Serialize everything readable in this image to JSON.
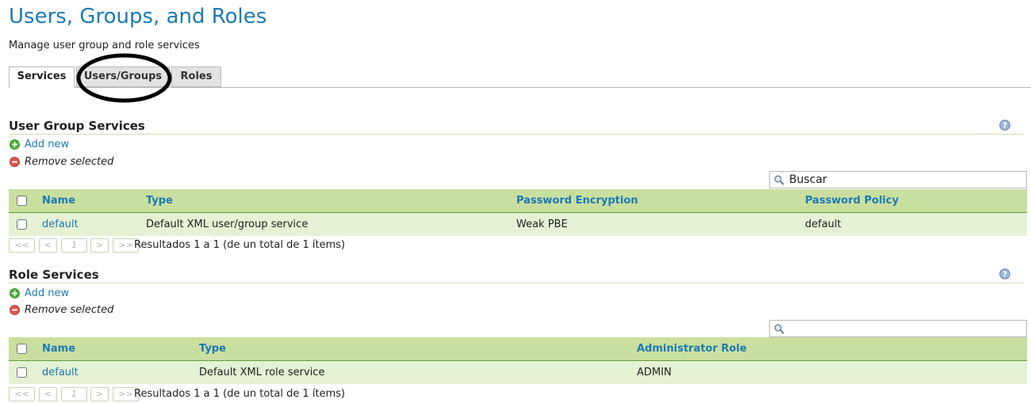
{
  "page": {
    "title": "Users, Groups, and Roles",
    "subtitle": "Manage user group and role services"
  },
  "tabs": [
    {
      "label": "Services",
      "active": true
    },
    {
      "label": "Users/Groups",
      "active": false
    },
    {
      "label": "Roles",
      "active": false
    }
  ],
  "user_group_services": {
    "heading": "User Group Services",
    "add_label": "Add new",
    "remove_label": "Remove selected",
    "search_placeholder": "Buscar",
    "columns": [
      "Name",
      "Type",
      "Password Encryption",
      "Password Policy"
    ],
    "rows": [
      {
        "name": "default",
        "type": "Default XML user/group service",
        "encryption": "Weak PBE",
        "policy": "default"
      }
    ],
    "pager": {
      "first": "<<",
      "prev": "<",
      "page": "1",
      "next": ">",
      "last": ">>",
      "result": "Resultados 1 a 1 (de un total de 1 ítems)"
    }
  },
  "role_services": {
    "heading": "Role Services",
    "add_label": "Add new",
    "remove_label": "Remove selected",
    "search_placeholder": "",
    "columns": [
      "Name",
      "Type",
      "Administrator Role"
    ],
    "rows": [
      {
        "name": "default",
        "type": "Default XML role service",
        "admin_role": "ADMIN"
      }
    ],
    "pager": {
      "first": "<<",
      "prev": "<",
      "page": "1",
      "next": ">",
      "last": ">>",
      "result": "Resultados 1 a 1 (de un total de 1 ítems)"
    }
  },
  "colors": {
    "title": "#1d7ab5",
    "header_row": "#c9df9f",
    "data_row": "#e5f1d3",
    "link": "#1d7ab5",
    "add_icon": "#4caf3c",
    "remove_icon": "#d9534f"
  },
  "icons": {
    "add": "add-icon",
    "remove": "remove-icon",
    "help": "help-icon",
    "search": "magnifier-icon"
  }
}
